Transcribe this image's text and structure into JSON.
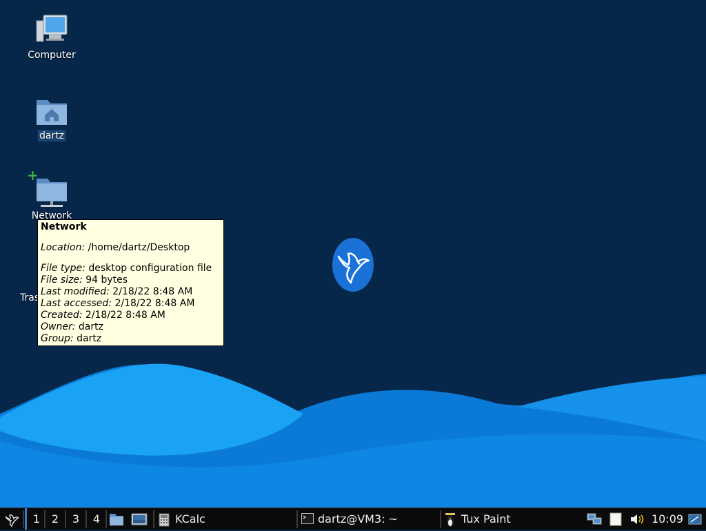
{
  "desktop": {
    "icons": [
      {
        "label": "Computer",
        "icon": "computer-icon"
      },
      {
        "label": "dartz",
        "icon": "home-folder-icon"
      },
      {
        "label": "Network",
        "icon": "network-folder-icon"
      },
      {
        "label": "Tras",
        "icon": "trash-icon"
      }
    ],
    "logo": "hummingbird-logo"
  },
  "tooltip": {
    "title": "Network",
    "location_key": "Location:",
    "location_val": " /home/dartz/Desktop",
    "type_key": "File type:",
    "type_val": " desktop configuration file",
    "size_key": "File size:",
    "size_val": " 94 bytes",
    "modified_key": "Last modified:",
    "modified_val": " 2/18/22 8:48 AM",
    "accessed_key": "Last accessed:",
    "accessed_val": " 2/18/22 8:48 AM",
    "created_key": "Created:",
    "created_val": " 2/18/22 8:48 AM",
    "owner_key": "Owner:",
    "owner_val": " dartz",
    "group_key": "Group:",
    "group_val": " dartz"
  },
  "taskbar": {
    "workspaces": [
      "1",
      "2",
      "3",
      "4"
    ],
    "tasks": [
      {
        "label": "KCalc",
        "icon": "calculator-icon"
      },
      {
        "label": "dartz@VM3: ~",
        "icon": "terminal-icon"
      },
      {
        "label": "Tux Paint",
        "icon": "tux-paint-icon"
      }
    ],
    "clock": "10:09"
  },
  "colors": {
    "background": "#06274a",
    "wave_light": "#1a9af0",
    "wave_mid": "#0b7fe0",
    "tooltip_bg": "#ffffe1",
    "taskbar_bg": "#0b0b0b",
    "workspace_accent": "#3d7cc9"
  }
}
